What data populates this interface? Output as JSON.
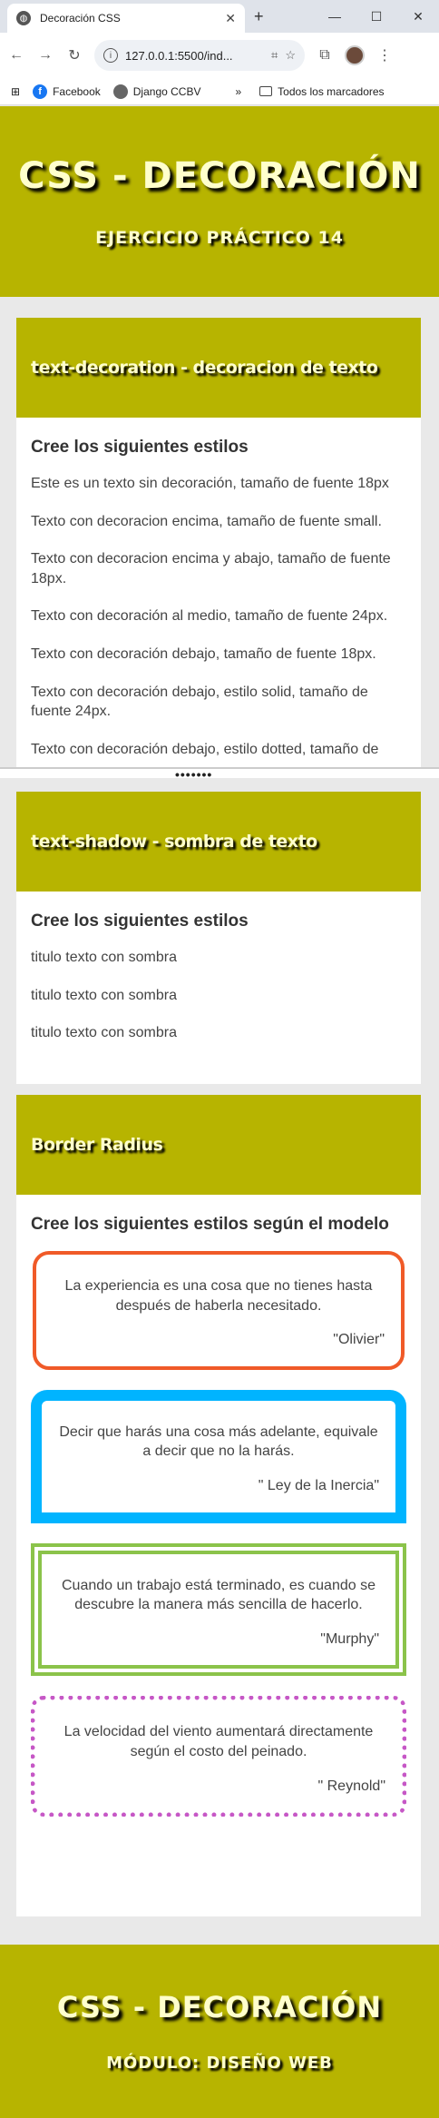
{
  "browser": {
    "tab_title": "Decoración CSS",
    "tab_icon": "globe-icon",
    "url": "127.0.0.1:5500/ind...",
    "bookmarks": [
      {
        "label": "Facebook",
        "icon": "facebook-icon"
      },
      {
        "label": "Django CCBV",
        "icon": "globe-icon"
      }
    ],
    "bookmarks_folder": "Todos los marcadores"
  },
  "hero": {
    "title": "CSS - DECORACIÓN",
    "subtitle": "EJERCICIO PRÁCTICO 14"
  },
  "section_text_decoration": {
    "header": "text-decoration - decoracion de texto",
    "heading": "Cree los siguientes estilos",
    "items": [
      "Este es un texto sin decoración, tamaño de fuente 18px",
      "Texto con decoracion encima, tamaño de fuente small.",
      "Texto con decoracion encima y abajo, tamaño de fuente 18px.",
      "Texto con decoración al medio, tamaño de fuente 24px.",
      "Texto con decoración debajo, tamaño de fuente 18px.",
      "Texto con decoración debajo, estilo solid, tamaño de fuente 24px.",
      "Texto con decoración debajo, estilo dotted, tamaño de"
    ]
  },
  "scroll_dots": "•••••••",
  "section_text_shadow": {
    "header": "text-shadow - sombra de texto",
    "heading": "Cree los siguientes estilos",
    "items": [
      "titulo texto con sombra",
      "titulo texto con sombra",
      "titulo texto con sombra"
    ]
  },
  "section_border_radius": {
    "header": "Border Radius",
    "heading": "Cree los siguientes estilos según el modelo",
    "quotes": [
      {
        "text": "La experiencia es una cosa que no tienes hasta después de haberla necesitado.",
        "author": "\"Olivier\"",
        "color": "#f05a28"
      },
      {
        "text": "Decir que harás una cosa más adelante, equivale a decir que no la harás.",
        "author": "\" Ley de la Inercia\"",
        "color": "#00b4ff"
      },
      {
        "text": "Cuando un trabajo está terminado, es cuando se descubre la manera más sencilla de hacerlo.",
        "author": "\"Murphy\"",
        "color": "#8bc34a"
      },
      {
        "text": "La velocidad del viento aumentará directamente según el costo del peinado.",
        "author": "\" Reynold\"",
        "color": "#c657c6"
      }
    ]
  },
  "footer": {
    "title": "CSS - DECORACIÓN",
    "subtitle": "MÓDULO: DISEÑO WEB"
  },
  "colors": {
    "brand": "#b7b400",
    "heading_text": "#ffffcc"
  }
}
